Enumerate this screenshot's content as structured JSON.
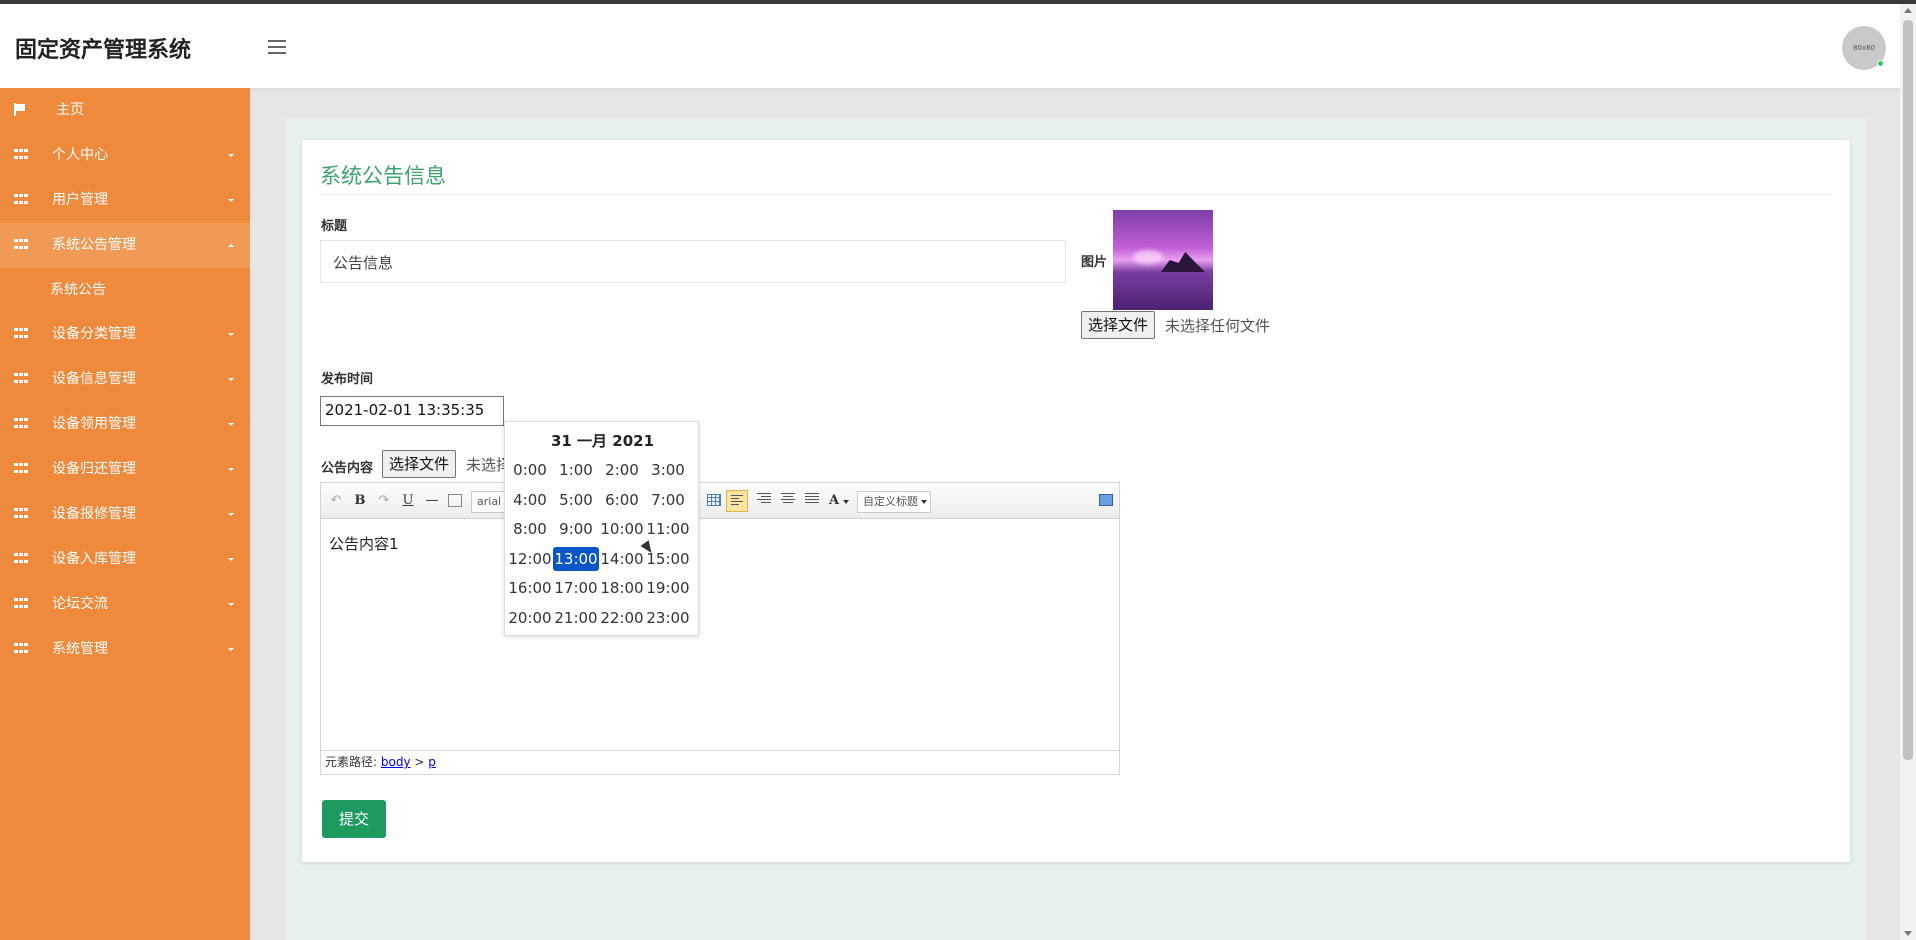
{
  "app": {
    "title": "固定资产管理系统"
  },
  "header": {
    "avatar_text": "80x80"
  },
  "sidebar": {
    "home": "主页",
    "items": [
      {
        "label": "个人中心"
      },
      {
        "label": "用户管理"
      },
      {
        "label": "系统公告管理",
        "expanded": true,
        "subitems": [
          "系统公告"
        ]
      },
      {
        "label": "设备分类管理"
      },
      {
        "label": "设备信息管理"
      },
      {
        "label": "设备领用管理"
      },
      {
        "label": "设备归还管理"
      },
      {
        "label": "设备报修管理"
      },
      {
        "label": "设备入库管理"
      },
      {
        "label": "论坛交流"
      },
      {
        "label": "系统管理"
      }
    ]
  },
  "form": {
    "heading": "系统公告信息",
    "title_label": "标题",
    "title_value": "公告信息",
    "image_label": "图片",
    "file_button": "选择文件",
    "file_none": "未选择任何文件",
    "file_none_partial": "未选择",
    "publish_label": "发布时间",
    "publish_value": "2021-02-01 13:35:35",
    "content_label": "公告内容",
    "submit": "提交"
  },
  "editor": {
    "font_select": "arial",
    "heading_select": "自定义标题",
    "body_text": "公告内容1",
    "path_label": "元素路径:",
    "path_body": "body",
    "path_sep": ">",
    "path_p": "p",
    "buttons": {
      "undo": "↶",
      "bold": "B",
      "redo": "↷",
      "underline": "U",
      "hr": "—",
      "font_color": "A"
    }
  },
  "time_picker": {
    "header": "31 一月 2021",
    "hours": [
      "0:00",
      "1:00",
      "2:00",
      "3:00",
      "4:00",
      "5:00",
      "6:00",
      "7:00",
      "8:00",
      "9:00",
      "10:00",
      "11:00",
      "12:00",
      "13:00",
      "14:00",
      "15:00",
      "16:00",
      "17:00",
      "18:00",
      "19:00",
      "20:00",
      "21:00",
      "22:00",
      "23:00"
    ],
    "selected": "13:00"
  },
  "colors": {
    "sidebar": "#ef8a3c",
    "accent_green": "#3ba46c",
    "submit": "#1f9a5f",
    "selected_hour": "#0b56c7"
  }
}
